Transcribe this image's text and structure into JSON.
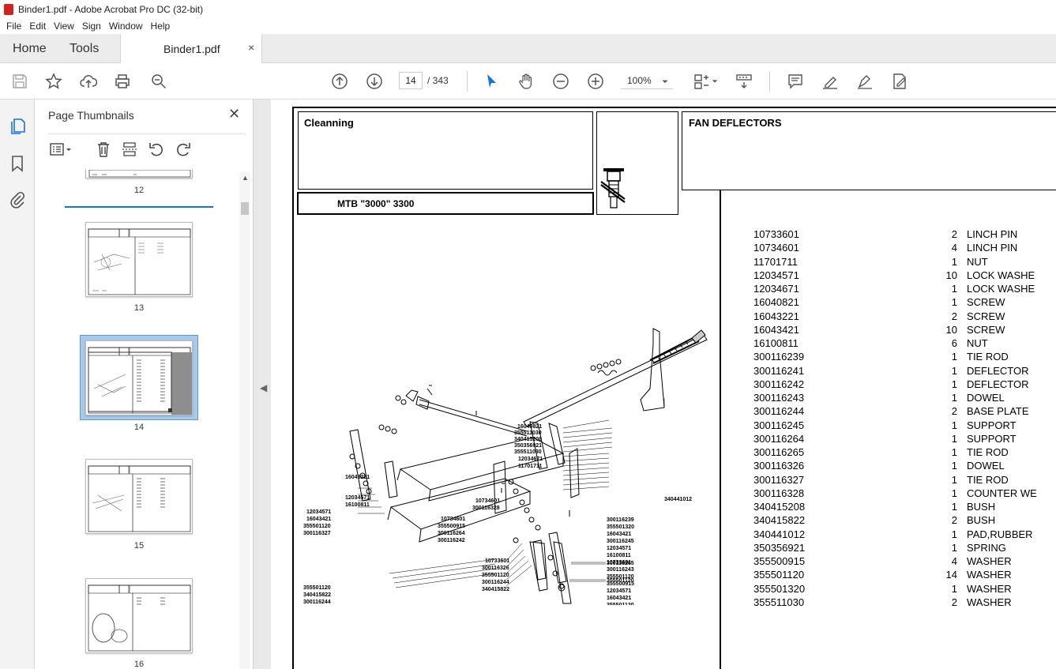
{
  "window": {
    "title": "Binder1.pdf - Adobe Acrobat Pro DC (32-bit)"
  },
  "menu": [
    "File",
    "Edit",
    "View",
    "Sign",
    "Window",
    "Help"
  ],
  "tabs": {
    "home": "Home",
    "tools": "Tools",
    "document": "Binder1.pdf",
    "close": "×"
  },
  "toolbar": {
    "page_current": "14",
    "page_total": "/ 343",
    "zoom": "100%"
  },
  "thumbnails": {
    "title": "Page Thumbnails",
    "close": "✕",
    "pages": [
      "12",
      "13",
      "14",
      "15",
      "16"
    ],
    "selected": "14"
  },
  "document": {
    "section": "Cleanning",
    "model": "MTB \"3000\" 3300",
    "assembly": "FAN DEFLECTORS",
    "parts": [
      {
        "num": "10733601",
        "qty": "2",
        "desc": "LINCH PIN"
      },
      {
        "num": "10734601",
        "qty": "4",
        "desc": "LINCH PIN"
      },
      {
        "num": "11701711",
        "qty": "1",
        "desc": "NUT"
      },
      {
        "num": "12034571",
        "qty": "10",
        "desc": "LOCK WASHE"
      },
      {
        "num": "12034671",
        "qty": "1",
        "desc": "LOCK WASHE"
      },
      {
        "num": "16040821",
        "qty": "1",
        "desc": "SCREW"
      },
      {
        "num": "16043221",
        "qty": "2",
        "desc": "SCREW"
      },
      {
        "num": "16043421",
        "qty": "10",
        "desc": "SCREW"
      },
      {
        "num": "16100811",
        "qty": "6",
        "desc": "NUT"
      },
      {
        "num": "300116239",
        "qty": "1",
        "desc": "TIE ROD"
      },
      {
        "num": "300116241",
        "qty": "1",
        "desc": "DEFLECTOR"
      },
      {
        "num": "300116242",
        "qty": "1",
        "desc": "DEFLECTOR"
      },
      {
        "num": "300116243",
        "qty": "1",
        "desc": "DOWEL"
      },
      {
        "num": "300116244",
        "qty": "2",
        "desc": "BASE PLATE"
      },
      {
        "num": "300116245",
        "qty": "1",
        "desc": "SUPPORT"
      },
      {
        "num": "300116264",
        "qty": "1",
        "desc": "SUPPORT"
      },
      {
        "num": "300116265",
        "qty": "1",
        "desc": "TIE ROD"
      },
      {
        "num": "300116326",
        "qty": "1",
        "desc": "DOWEL"
      },
      {
        "num": "300116327",
        "qty": "1",
        "desc": "TIE ROD"
      },
      {
        "num": "300116328",
        "qty": "1",
        "desc": "COUNTER WE"
      },
      {
        "num": "340415208",
        "qty": "1",
        "desc": "BUSH"
      },
      {
        "num": "340415822",
        "qty": "2",
        "desc": "BUSH"
      },
      {
        "num": "340441012",
        "qty": "1",
        "desc": "PAD,RUBBER"
      },
      {
        "num": "350356921",
        "qty": "1",
        "desc": "SPRING"
      },
      {
        "num": "355500915",
        "qty": "4",
        "desc": "WASHER"
      },
      {
        "num": "355501120",
        "qty": "14",
        "desc": "WASHER"
      },
      {
        "num": "355501320",
        "qty": "1",
        "desc": "WASHER"
      },
      {
        "num": "355511030",
        "qty": "2",
        "desc": "WASHER"
      }
    ],
    "callouts_top": [
      "16040821",
      "355511030",
      "340415208",
      "350356921",
      "355511030",
      "12034671",
      "11701711"
    ],
    "callouts_left": [
      "16043221",
      "12034571",
      "16100811",
      "12034571",
      "16043421",
      "355501120",
      "300116327"
    ],
    "callouts_mid": [
      "10734601",
      "300116328",
      "10734601",
      "355500915",
      "300116264",
      "300116242"
    ],
    "callouts_right": [
      "300116239",
      "355501320",
      "16043421",
      "300116245",
      "12034571",
      "16100811",
      "10733601",
      "300116243",
      "355501120",
      "355500915",
      "12034571",
      "16043421",
      "355501120"
    ],
    "callouts_lower_left": [
      "355501120",
      "340415822",
      "300116244",
      "355501120",
      "300116241"
    ],
    "callouts_bottom": [
      "10733601",
      "300116326",
      "355501120",
      "300116244",
      "340415822"
    ],
    "callout_pad": "340441012",
    "callout_265": "300116265",
    "callout_bottom_right": "355501120"
  }
}
